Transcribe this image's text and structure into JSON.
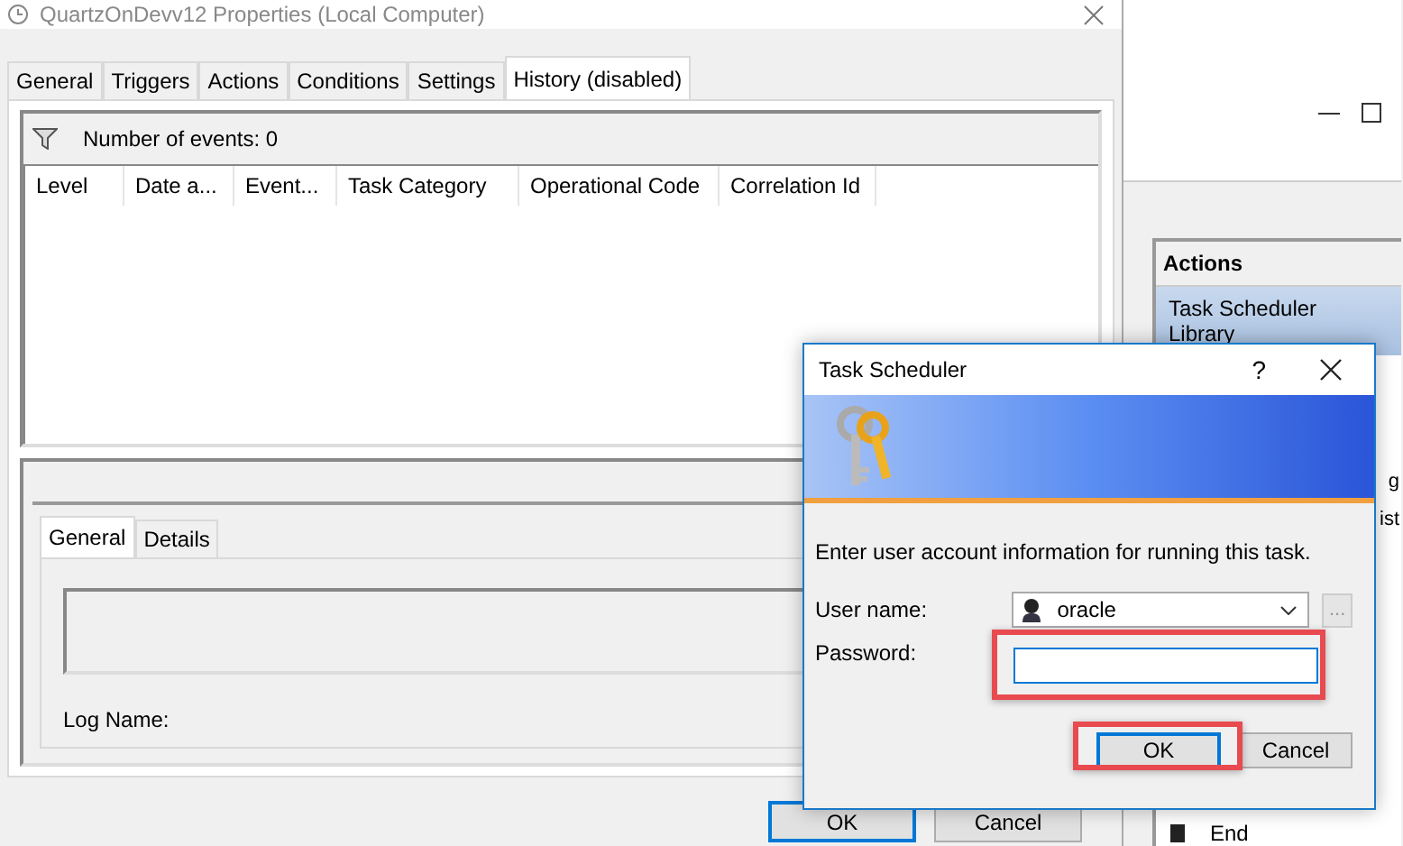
{
  "properties_window": {
    "title": "QuartzOnDevv12 Properties (Local Computer)",
    "tabs": [
      {
        "label": "General",
        "selected": false
      },
      {
        "label": "Triggers",
        "selected": false
      },
      {
        "label": "Actions",
        "selected": false
      },
      {
        "label": "Conditions",
        "selected": false
      },
      {
        "label": "Settings",
        "selected": false
      },
      {
        "label": "History (disabled)",
        "selected": true
      }
    ],
    "events_count": "Number of events: 0",
    "columns": [
      "Level",
      "Date a...",
      "Event...",
      "Task Category",
      "Operational Code",
      "Correlation Id"
    ],
    "detail_tabs": [
      {
        "label": "General",
        "selected": true
      },
      {
        "label": "Details",
        "selected": false
      }
    ],
    "log_name_label": "Log Name:",
    "buttons": [
      {
        "label": "OK",
        "default": true
      },
      {
        "label": "Cancel",
        "default": false
      }
    ]
  },
  "background_window": {
    "actions_header": "Actions",
    "actions": [
      {
        "label": "Task Scheduler Library",
        "selected": true
      }
    ],
    "fragments": [
      "g",
      "ist"
    ],
    "last_action": "End"
  },
  "dialog": {
    "title": "Task Scheduler",
    "help": "?",
    "prompt": "Enter user account information for running this task.",
    "user_label": "User name:",
    "user_value": "oracle",
    "browse_button": {
      "label": "...",
      "disabled": true
    },
    "password_label": "Password:",
    "buttons": [
      {
        "label": "OK",
        "default": true
      },
      {
        "label": "Cancel",
        "default": false
      }
    ]
  }
}
